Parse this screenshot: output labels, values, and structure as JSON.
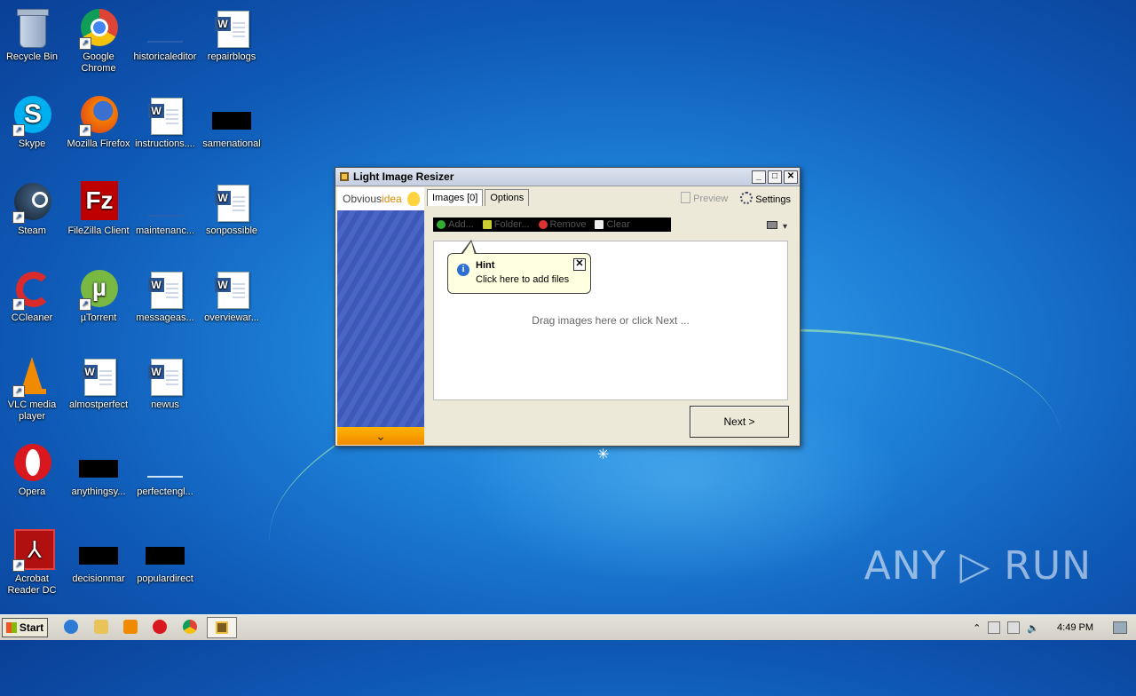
{
  "desktop": {
    "icons": [
      {
        "label": "Recycle Bin"
      },
      {
        "label": "Google Chrome"
      },
      {
        "label": "historicaleditor"
      },
      {
        "label": "repairblogs"
      },
      {
        "label": "Skype"
      },
      {
        "label": "Mozilla Firefox"
      },
      {
        "label": "instructions...."
      },
      {
        "label": "samenational"
      },
      {
        "label": "Steam"
      },
      {
        "label": "FileZilla Client"
      },
      {
        "label": "maintenanc..."
      },
      {
        "label": "sonpossible"
      },
      {
        "label": "CCleaner"
      },
      {
        "label": "µTorrent"
      },
      {
        "label": "messageas..."
      },
      {
        "label": "overviewar..."
      },
      {
        "label": "VLC media player"
      },
      {
        "label": "almostperfect"
      },
      {
        "label": "newus"
      },
      {
        "label": "Opera"
      },
      {
        "label": "anythingsy..."
      },
      {
        "label": "perfectengl..."
      },
      {
        "label": "Acrobat Reader DC"
      },
      {
        "label": "decisionmar"
      },
      {
        "label": "populardirect"
      }
    ]
  },
  "window": {
    "title": "Light Image Resizer",
    "brand": {
      "part1": "Obvious",
      "part2": "idea"
    },
    "tabs": [
      {
        "label": "Images [0]",
        "active": true
      },
      {
        "label": "Options",
        "active": false
      }
    ],
    "preview_label": "Preview",
    "settings_label": "Settings",
    "toolbar": {
      "add_label": "Add...",
      "folder_label": "Folder...",
      "remove_label": "Remove",
      "clear_label": "Clear"
    },
    "drop_message": "Drag images here or click Next ...",
    "hint": {
      "title": "Hint",
      "text": "Click here to add files"
    },
    "next_label": "Next >",
    "sidebar_arrow": "⌄"
  },
  "taskbar": {
    "start_label": "Start",
    "clock": "4:49 PM"
  },
  "watermark": "ANY ▷ RUN",
  "colors": {
    "desktop_blue": "#1d7fd6",
    "window_bg": "#ece9d8",
    "hint_bg": "#ffffe1",
    "sidebar_blue": "#4a66c4",
    "sidebar_orange": "#f08a00"
  }
}
